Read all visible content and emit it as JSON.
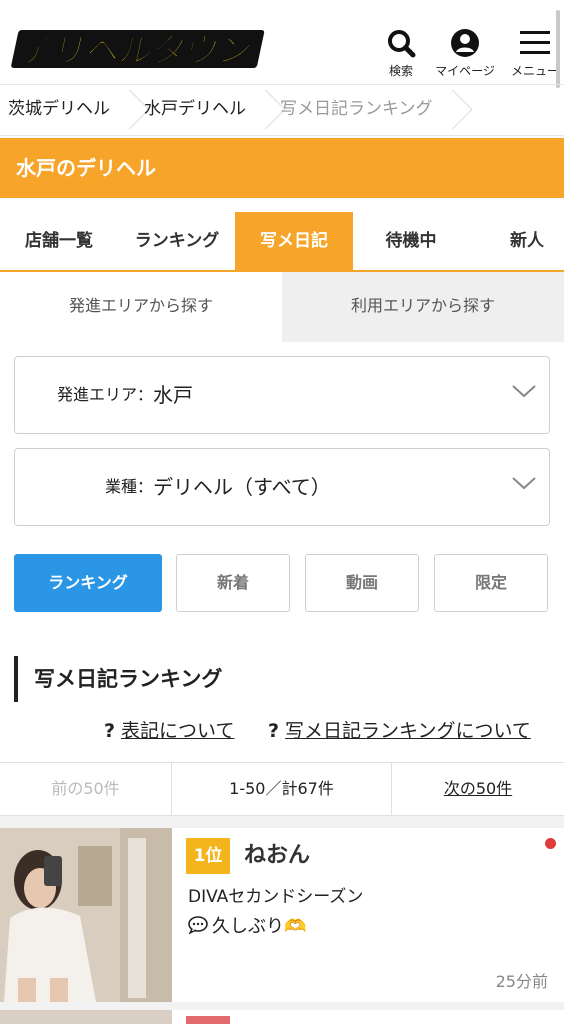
{
  "header": {
    "logo_text": "デリヘルタウン",
    "search_label": "検索",
    "mypage_label": "マイページ",
    "menu_label": "メニュー"
  },
  "breadcrumb": [
    {
      "label": "茨城デリヘル"
    },
    {
      "label": "水戸デリヘル"
    },
    {
      "label": "写メ日記ランキング"
    }
  ],
  "area_title": "水戸のデリヘル",
  "main_tabs": [
    {
      "label": "店舗一覧",
      "active": false
    },
    {
      "label": "ランキング",
      "active": false
    },
    {
      "label": "写メ日記",
      "active": true
    },
    {
      "label": "待機中",
      "active": false
    },
    {
      "label": "新人",
      "active": false
    }
  ],
  "search_tabs": [
    {
      "label": "発進エリアから探す",
      "active": true
    },
    {
      "label": "利用エリアから探す",
      "active": false
    }
  ],
  "selects": {
    "area": {
      "label": "発進エリア：",
      "value": "水戸"
    },
    "type": {
      "label": "業種：",
      "value": "デリヘル（すべて）"
    }
  },
  "filters": [
    {
      "label": "ランキング",
      "active": true
    },
    {
      "label": "新着",
      "active": false
    },
    {
      "label": "動画",
      "active": false
    },
    {
      "label": "限定",
      "active": false
    }
  ],
  "section_title": "写メ日記ランキング",
  "help_links": [
    {
      "label": "表記について"
    },
    {
      "label": "写メ日記ランキングについて"
    }
  ],
  "pager": {
    "prev": "前の50件",
    "count": "1-50／計67件",
    "next": "次の50件"
  },
  "ranking": [
    {
      "rank": "1位",
      "name": "ねおん",
      "shop": "DIVAセカンドシーズン",
      "comment": "久しぶり🫶",
      "time": "25分前"
    }
  ],
  "colors": {
    "accent_orange": "#f6a52a",
    "active_blue": "#2c96e6",
    "rank_gold": "#f3b51b",
    "new_dot_red": "#e03b3b"
  }
}
